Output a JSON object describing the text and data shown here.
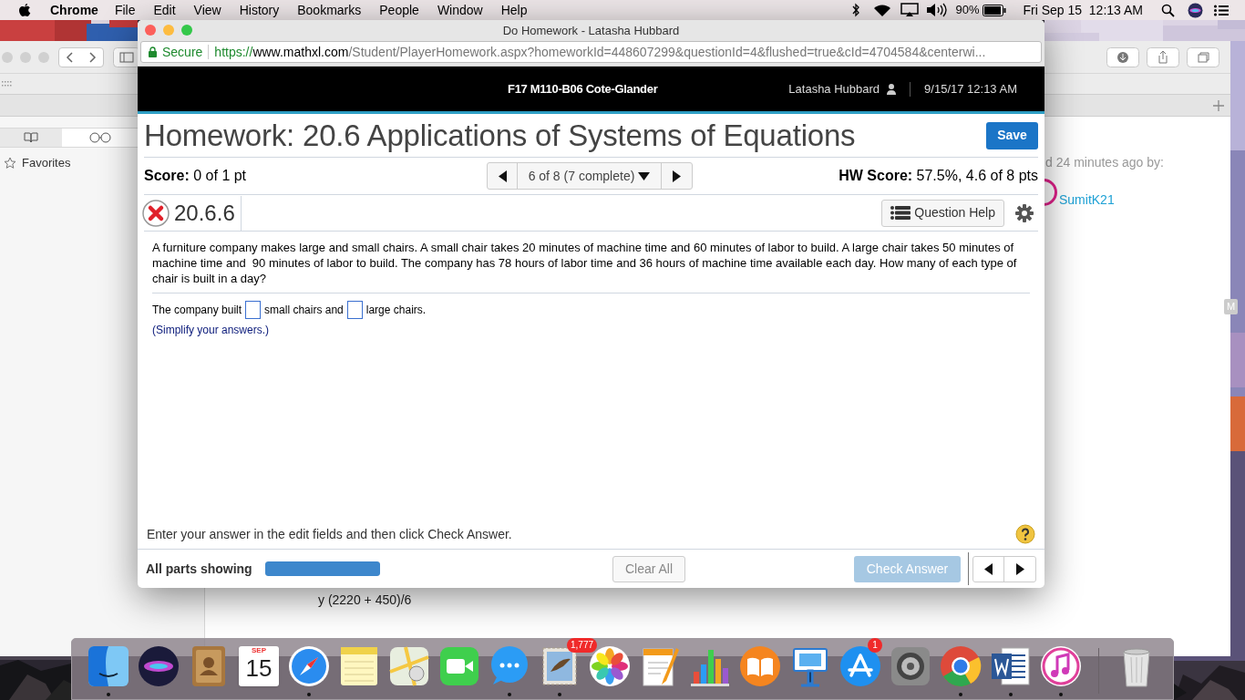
{
  "menu_bar": {
    "app": "Chrome",
    "menus": [
      "File",
      "Edit",
      "View",
      "History",
      "Bookmarks",
      "People",
      "Window",
      "Help"
    ],
    "battery": "90%",
    "clock": "Fri Sep 15  12:13 AM"
  },
  "background_window": {
    "sidebar_item": "Favorites",
    "activity_text": "d 24 minutes ago by:",
    "user_link": "SumitK21",
    "formula": "y (2220 + 450)/6",
    "edge_badge": "M"
  },
  "browser": {
    "title": "Do Homework - Latasha Hubbard",
    "secure_label": "Secure",
    "url_scheme": "https://",
    "url_domain": "www.mathxl.com",
    "url_path": "/Student/PlayerHomework.aspx?homeworkId=448607299&questionId=4&flushed=true&cId=4704584&centerwi..."
  },
  "header": {
    "course": "F17 M110-B06 Cote-Glander",
    "user": "Latasha Hubbard",
    "datetime": "9/15/17 12:13 AM"
  },
  "homework": {
    "title": "Homework: 20.6 Applications of Systems of Equations",
    "save": "Save",
    "score": "**Score:** 0 of 1 pt",
    "nav": "6 of 8 (7 complete)",
    "hw_score": "**HW Score:** 57.5%, 4.6 of 8 pts"
  },
  "question": {
    "correct": false,
    "number": "20.6.6",
    "help": "Question Help",
    "text": "A furniture company makes large and small chairs. A small chair takes 20 minutes of machine time and 60 minutes of labor to build. A large chair takes 50 minutes of machine time and  90 minutes of labor to build. The company has 78 hours of labor time and 36 hours of machine time available each day. How many of each type of chair is built in a day?",
    "answer": [
      {
        "kind": "text",
        "text": "The company built"
      },
      {
        "kind": "blank"
      },
      {
        "kind": "text",
        "text": "small chairs and"
      },
      {
        "kind": "blank"
      },
      {
        "kind": "text",
        "text": "large chairs."
      }
    ],
    "hint": "(Simplify your answers.)"
  },
  "footer": {
    "instruction": "Enter your answer in the edit fields and then click Check Answer.",
    "parts_label": "All parts showing",
    "level": 1,
    "clear": "Clear All",
    "check": "Check Answer",
    "check_disabled": true
  },
  "dock": [
    {
      "kind": "finder",
      "running": true
    },
    {
      "kind": "siri",
      "running": false
    },
    {
      "kind": "contacts",
      "running": false
    },
    {
      "kind": "calendar",
      "running": false,
      "month": "SEP",
      "day": "15"
    },
    {
      "kind": "safari",
      "running": true
    },
    {
      "kind": "notes",
      "running": false
    },
    {
      "kind": "maps",
      "running": false
    },
    {
      "kind": "facetime",
      "running": false
    },
    {
      "kind": "messages",
      "running": true
    },
    {
      "kind": "mail",
      "running": true,
      "badge": "1,777"
    },
    {
      "kind": "photos",
      "running": false
    },
    {
      "kind": "pages",
      "running": false
    },
    {
      "kind": "numbers",
      "running": false
    },
    {
      "kind": "ibooks",
      "running": false
    },
    {
      "kind": "keynote",
      "running": false
    },
    {
      "kind": "appstore",
      "running": false,
      "badge": "1"
    },
    {
      "kind": "sysprefs",
      "running": false
    },
    {
      "kind": "chrome",
      "running": true
    },
    {
      "kind": "word",
      "running": true
    },
    {
      "kind": "itunes",
      "running": true
    },
    {
      "kind": "separator"
    },
    {
      "kind": "trash",
      "running": false
    }
  ]
}
